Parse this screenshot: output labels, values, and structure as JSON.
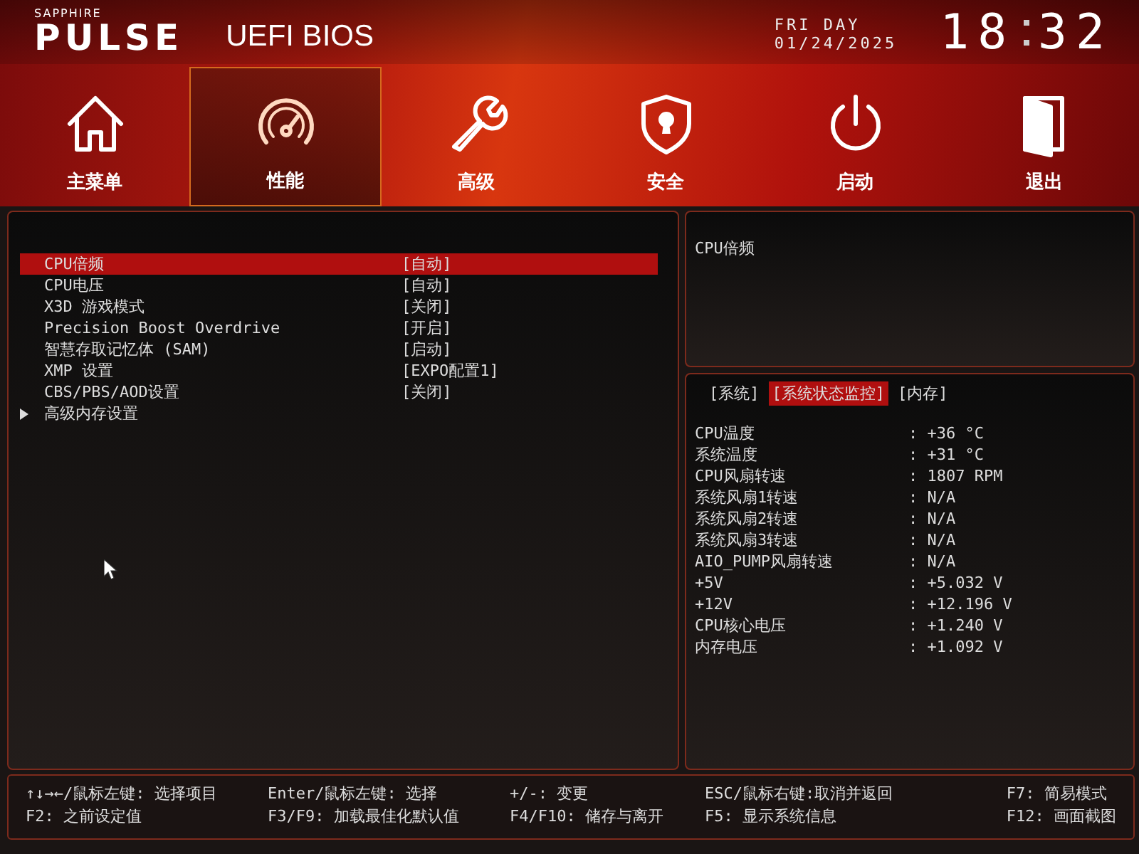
{
  "header": {
    "brand": "SAPPHIRE",
    "logo": "PULSE",
    "title": "UEFI BIOS",
    "day": "FRI DAY",
    "date": "01/24/2025",
    "hours": "18",
    "minutes": "32"
  },
  "nav": [
    {
      "label": "主菜单",
      "selected": false
    },
    {
      "label": "性能",
      "selected": true
    },
    {
      "label": "高级",
      "selected": false
    },
    {
      "label": "安全",
      "selected": false
    },
    {
      "label": "启动",
      "selected": false
    },
    {
      "label": "退出",
      "selected": false
    }
  ],
  "settings": [
    {
      "kind": "option",
      "label": "CPU倍频",
      "value": "[自动]",
      "selected": true
    },
    {
      "kind": "option",
      "label": "CPU电压",
      "value": "[自动]",
      "selected": false
    },
    {
      "kind": "option",
      "label": "X3D 游戏模式",
      "value": "[关闭]",
      "selected": false
    },
    {
      "kind": "option",
      "label": "Precision Boost Overdrive",
      "value": "[开启]",
      "selected": false
    },
    {
      "kind": "option",
      "label": "智慧存取记忆体 (SAM)",
      "value": "[启动]",
      "selected": false
    },
    {
      "kind": "option",
      "label": "XMP 设置",
      "value": "[EXPO配置1]",
      "selected": false
    },
    {
      "kind": "option",
      "label": "CBS/PBS/AOD设置",
      "value": "[关闭]",
      "selected": false
    },
    {
      "kind": "submenu",
      "label": "高级内存设置",
      "selected": false
    }
  ],
  "help": {
    "text": "CPU倍频"
  },
  "monitor_tabs": [
    {
      "label": "[系统]",
      "selected": false
    },
    {
      "label": "[系统状态监控]",
      "selected": true
    },
    {
      "label": "[内存]",
      "selected": false
    }
  ],
  "monitor": [
    {
      "label": "CPU温度",
      "value": ": +36 °C"
    },
    {
      "label": "系统温度",
      "value": ": +31 °C"
    },
    {
      "label": "CPU风扇转速",
      "value": ": 1807 RPM"
    },
    {
      "label": "系统风扇1转速",
      "value": ": N/A"
    },
    {
      "label": "系统风扇2转速",
      "value": ": N/A"
    },
    {
      "label": "系统风扇3转速",
      "value": ": N/A"
    },
    {
      "label": "AIO_PUMP风扇转速",
      "value": ": N/A"
    },
    {
      "label": "+5V",
      "value": ": +5.032 V"
    },
    {
      "label": "+12V",
      "value": ": +12.196 V"
    },
    {
      "label": "CPU核心电压",
      "value": ": +1.240 V"
    },
    {
      "label": "内存电压",
      "value": ": +1.092 V"
    }
  ],
  "key_help": [
    [
      "↑↓→←/鼠标左键: 选择项目",
      "F2: 之前设定值"
    ],
    [
      "Enter/鼠标左键: 选择",
      "F3/F9: 加载最佳化默认值"
    ],
    [
      "+/-: 变更",
      "F4/F10: 储存与离开"
    ],
    [
      "ESC/鼠标右键:取消并返回",
      "F5: 显示系统信息"
    ],
    [
      "F7: 简易模式",
      "F12: 画面截图"
    ]
  ]
}
